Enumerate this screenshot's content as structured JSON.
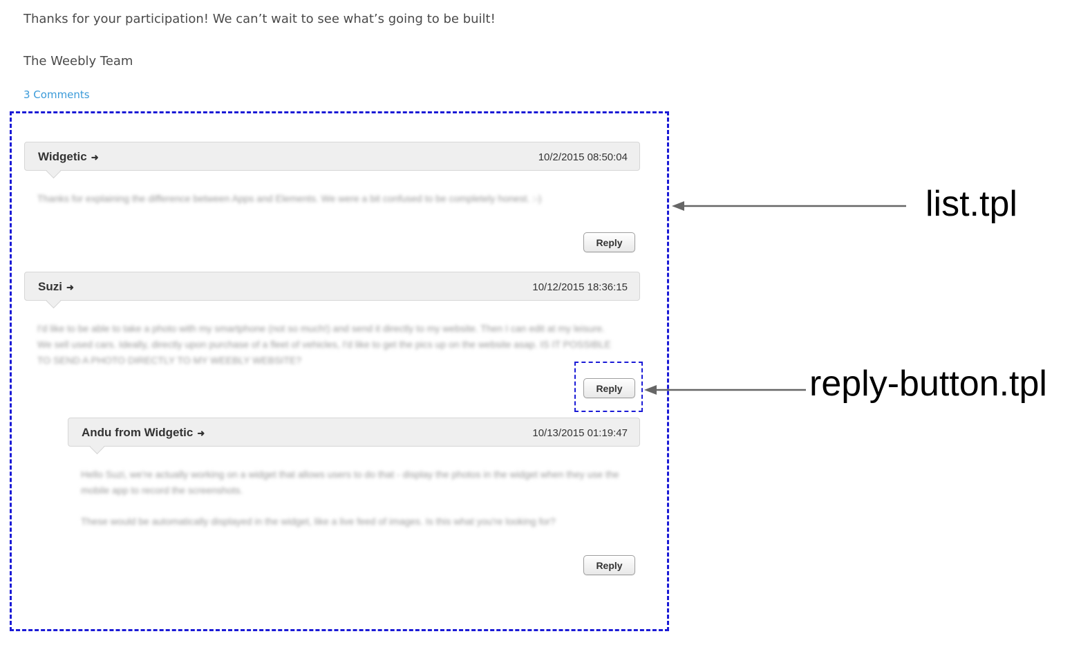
{
  "intro": {
    "thanks": "Thanks for your participation!  We can’t wait to see what’s going to be built!",
    "signature": "The Weebly Team",
    "comments_link": "3 Comments"
  },
  "comments": [
    {
      "author": "Widgetic",
      "timestamp": "10/2/2015 08:50:04",
      "body": [
        "Thanks for explaining the difference between Apps and Elements. We were a bit confused to be completely honest. :-)"
      ],
      "reply_label": "Reply"
    },
    {
      "author": "Suzi",
      "timestamp": "10/12/2015 18:36:15",
      "body": [
        "I'd like to be able to take a photo with my smartphone (not so much!) and send it directly to my website. Then I can edit at my leisure. We sell used cars. Ideally, directly upon purchase of a fleet of vehicles, I'd like to get the pics up on the website asap. IS IT POSSIBLE TO SEND A PHOTO DIRECTLY TO MY WEEBLY WEBSITE?"
      ],
      "reply_label": "Reply"
    },
    {
      "author": "Andu from Widgetic",
      "timestamp": "10/13/2015 01:19:47",
      "body": [
        "Hello Suzi, we're actually working on a widget that allows users to do that - display the photos in the widget when they use the mobile app to record the screenshots.",
        "These would be automatically displayed in the widget, like a live feed of images. Is this what you're looking for?"
      ],
      "reply_label": "Reply"
    }
  ],
  "annotations": {
    "list_label": "list.tpl",
    "reply_label": "reply-button.tpl",
    "box_color": "#1a1ad6",
    "arrow_color": "#666666"
  },
  "icons": {
    "author_link": "arrow-right-icon"
  }
}
